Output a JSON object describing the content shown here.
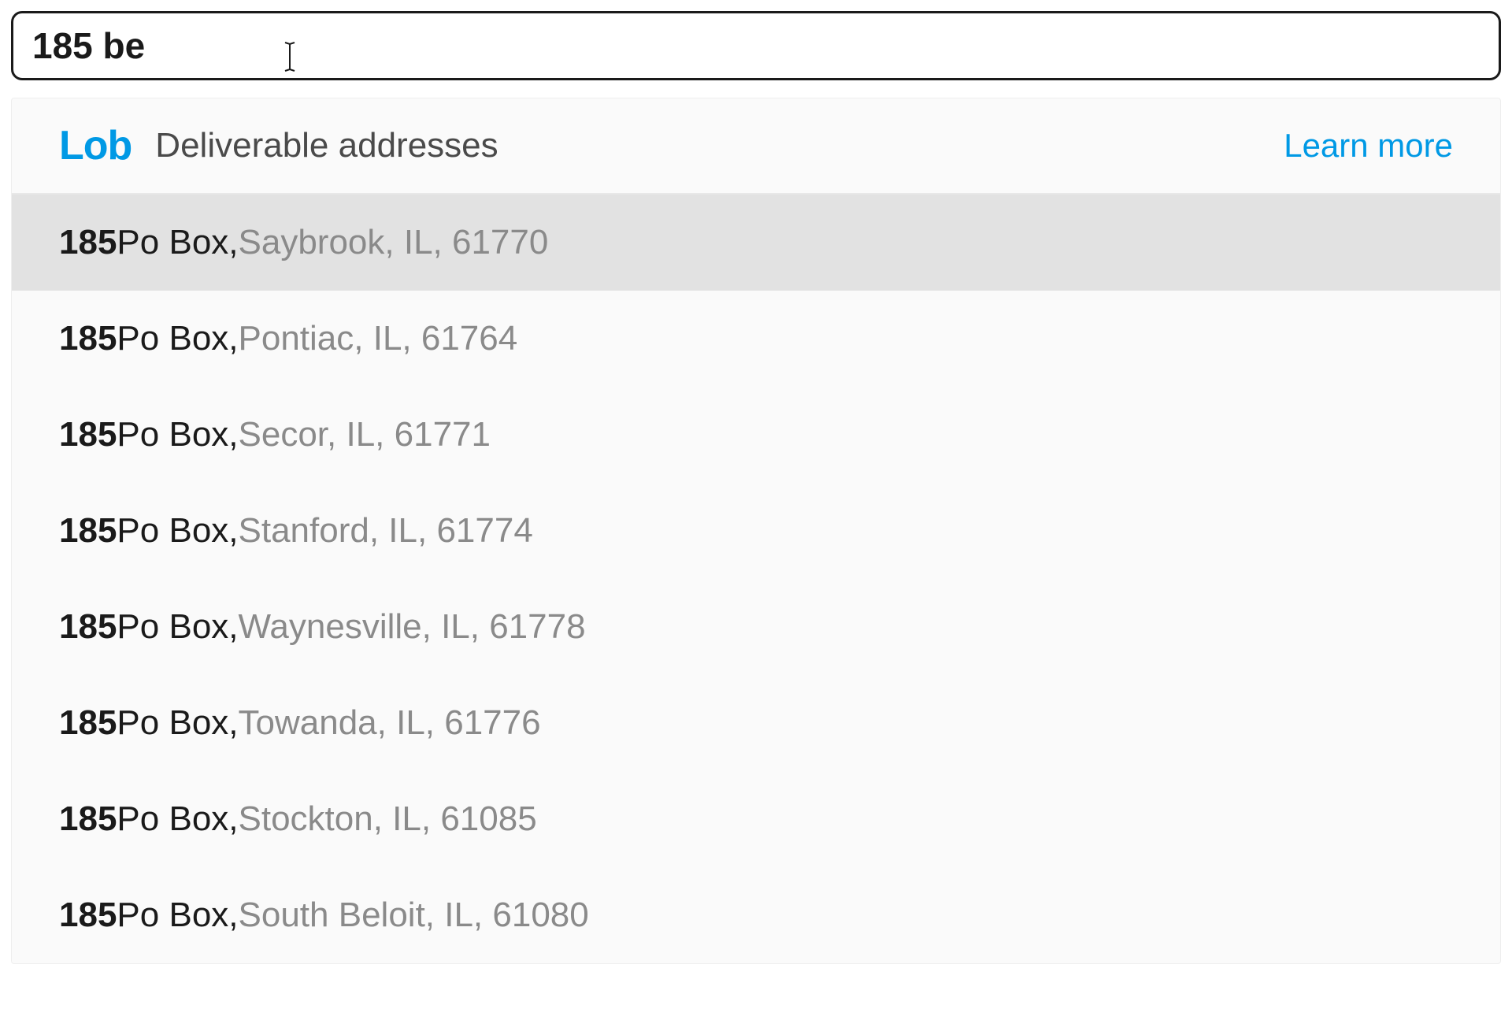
{
  "search": {
    "value": "185 be"
  },
  "dropdown": {
    "logo_text": "Lob",
    "header_title": "Deliverable addresses",
    "learn_more_label": "Learn more"
  },
  "suggestions": [
    {
      "primary": "185",
      "secondary": " Po Box, ",
      "region": "Saybrook, IL, 61770",
      "highlighted": true
    },
    {
      "primary": "185",
      "secondary": " Po Box, ",
      "region": "Pontiac, IL, 61764",
      "highlighted": false
    },
    {
      "primary": "185",
      "secondary": " Po Box, ",
      "region": "Secor, IL, 61771",
      "highlighted": false
    },
    {
      "primary": "185",
      "secondary": " Po Box, ",
      "region": "Stanford, IL, 61774",
      "highlighted": false
    },
    {
      "primary": "185",
      "secondary": " Po Box, ",
      "region": "Waynesville, IL, 61778",
      "highlighted": false
    },
    {
      "primary": "185",
      "secondary": " Po Box, ",
      "region": "Towanda, IL, 61776",
      "highlighted": false
    },
    {
      "primary": "185",
      "secondary": " Po Box, ",
      "region": "Stockton, IL, 61085",
      "highlighted": false
    },
    {
      "primary": "185",
      "secondary": " Po Box, ",
      "region": "South Beloit, IL, 61080",
      "highlighted": false
    }
  ]
}
